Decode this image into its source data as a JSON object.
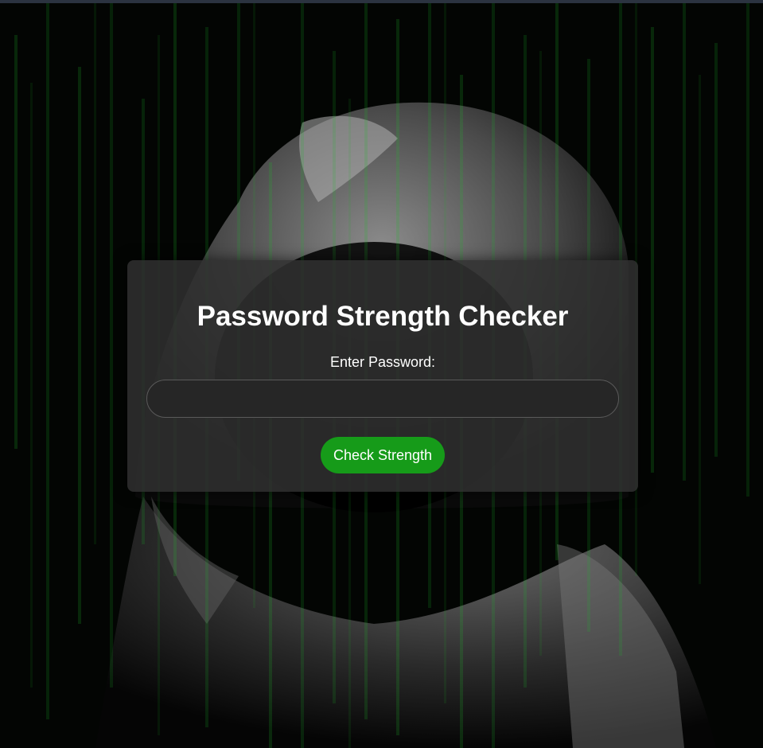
{
  "checker": {
    "title": "Password Strength Checker",
    "password_label": "Enter Password:",
    "password_value": "",
    "password_placeholder": "",
    "check_button_label": "Check Strength"
  },
  "theme": {
    "background": "#000000",
    "matrix_green": "#1fbf2a",
    "card_background": "#303030",
    "button_green": "#169b19",
    "text_color": "#ffffff"
  },
  "background_image": {
    "description_icon": "hooded-figure-matrix-icon"
  }
}
